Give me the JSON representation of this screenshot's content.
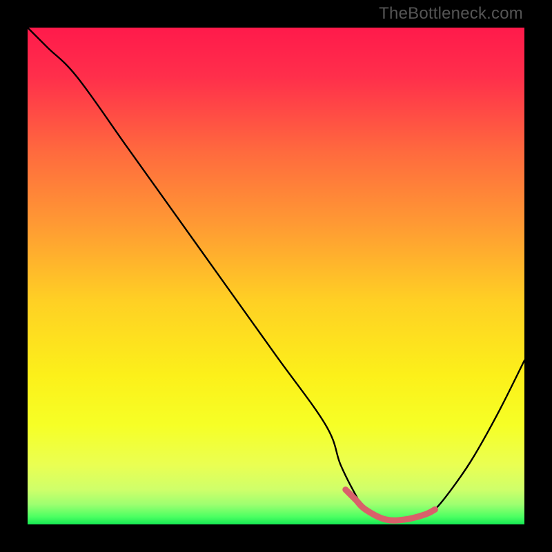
{
  "watermark": "TheBottleneck.com",
  "chart_data": {
    "type": "line",
    "title": "",
    "xlabel": "",
    "ylabel": "",
    "xlim": [
      0,
      100
    ],
    "ylim": [
      0,
      100
    ],
    "series": [
      {
        "name": "bottleneck-curve",
        "x": [
          0,
          4,
          10,
          20,
          30,
          40,
          50,
          60,
          63,
          66,
          68,
          72,
          76,
          80,
          82,
          86,
          90,
          95,
          100
        ],
        "values": [
          100,
          96,
          90,
          76,
          62,
          48,
          34,
          20,
          12,
          6,
          3,
          1,
          1,
          2,
          3,
          8,
          14,
          23,
          33
        ]
      },
      {
        "name": "optimal-range-highlight",
        "x": [
          64,
          66,
          68,
          72,
          76,
          80,
          82
        ],
        "values": [
          7,
          5,
          3,
          1,
          1,
          2,
          3
        ]
      }
    ],
    "gradient_stops": [
      {
        "pos": 0.0,
        "color": "#ff1a4b"
      },
      {
        "pos": 0.1,
        "color": "#ff2f4b"
      },
      {
        "pos": 0.25,
        "color": "#ff6a3e"
      },
      {
        "pos": 0.4,
        "color": "#ff9b33"
      },
      {
        "pos": 0.55,
        "color": "#ffd024"
      },
      {
        "pos": 0.7,
        "color": "#fcf01a"
      },
      {
        "pos": 0.8,
        "color": "#f6ff26"
      },
      {
        "pos": 0.88,
        "color": "#eaff52"
      },
      {
        "pos": 0.93,
        "color": "#cfff6a"
      },
      {
        "pos": 0.96,
        "color": "#9dff70"
      },
      {
        "pos": 0.985,
        "color": "#4bff62"
      },
      {
        "pos": 1.0,
        "color": "#16e853"
      }
    ],
    "highlight_color": "#d9606a"
  }
}
